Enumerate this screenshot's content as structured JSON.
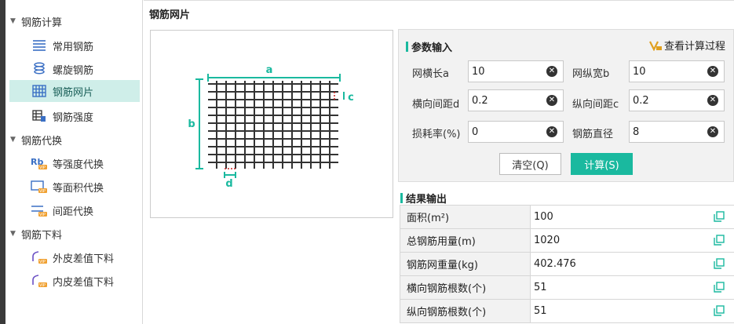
{
  "sidebar": {
    "groups": [
      {
        "label": "钢筋计算",
        "items": [
          {
            "label": "常用钢筋",
            "icon": "rebar-lines-icon"
          },
          {
            "label": "螺旋钢筋",
            "icon": "spiral-icon"
          },
          {
            "label": "钢筋网片",
            "icon": "grid-mesh-icon"
          },
          {
            "label": "钢筋强度",
            "icon": "strength-icon"
          }
        ]
      },
      {
        "label": "钢筋代换",
        "items": [
          {
            "label": "等强度代换",
            "icon": "rb-vip-icon"
          },
          {
            "label": "等面积代换",
            "icon": "area-vip-icon"
          },
          {
            "label": "间距代换",
            "icon": "spacing-vip-icon"
          }
        ]
      },
      {
        "label": "钢筋下料",
        "items": [
          {
            "label": "外皮差值下料",
            "icon": "bend-vip-icon"
          },
          {
            "label": "内皮差值下料",
            "icon": "bend-vip-icon"
          }
        ]
      }
    ],
    "active": "钢筋网片"
  },
  "main": {
    "title": "钢筋网片",
    "diagram_labels": {
      "a": "a",
      "b": "b",
      "c": "c",
      "d": "d"
    }
  },
  "input": {
    "title": "参数输入",
    "view_process": "查看计算过程",
    "fields": [
      {
        "label": "网横长a",
        "value": "10"
      },
      {
        "label": "网纵宽b",
        "value": "10"
      },
      {
        "label": "横向间距d",
        "value": "0.2"
      },
      {
        "label": "纵向间距c",
        "value": "0.2"
      },
      {
        "label": "损耗率(%)",
        "value": "0"
      },
      {
        "label": "钢筋直径",
        "value": "8"
      }
    ],
    "clear_label": "清空(Q)",
    "calc_label": "计算(S)"
  },
  "output": {
    "title": "结果输出",
    "rows": [
      {
        "label": "面积(m²)",
        "value": "100"
      },
      {
        "label": "总钢筋用量(m)",
        "value": "1020"
      },
      {
        "label": "钢筋网重量(kg)",
        "value": "402.476"
      },
      {
        "label": "横向钢筋根数(个)",
        "value": "51"
      },
      {
        "label": "纵向钢筋根数(个)",
        "value": "51"
      }
    ]
  },
  "colors": {
    "accent": "#1ab99f",
    "active_bg": "#cfeee9",
    "dim_red": "#cc2222"
  }
}
